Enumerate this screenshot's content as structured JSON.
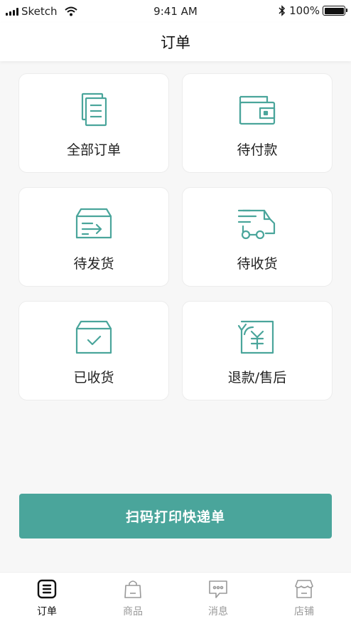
{
  "status_bar": {
    "carrier": "Sketch",
    "time": "9:41 AM",
    "battery": "100%"
  },
  "header": {
    "title": "订单"
  },
  "order_categories": [
    {
      "label": "全部订单",
      "icon": "documents-icon"
    },
    {
      "label": "待付款",
      "icon": "wallet-icon"
    },
    {
      "label": "待发货",
      "icon": "box-arrow-icon"
    },
    {
      "label": "待收货",
      "icon": "truck-icon"
    },
    {
      "label": "已收货",
      "icon": "box-check-icon"
    },
    {
      "label": "退款/售后",
      "icon": "yen-refund-icon"
    }
  ],
  "scan_button": {
    "label": "扫码打印快递单"
  },
  "tab_bar": {
    "items": [
      {
        "label": "订单",
        "icon": "order-list-icon",
        "active": true
      },
      {
        "label": "商品",
        "icon": "shopping-bag-icon",
        "active": false
      },
      {
        "label": "消息",
        "icon": "chat-icon",
        "active": false
      },
      {
        "label": "店铺",
        "icon": "store-icon",
        "active": false
      }
    ]
  },
  "colors": {
    "accent": "#4aa59b",
    "background": "#f7f7f7",
    "card": "#ffffff",
    "inactive_tab": "#999999"
  }
}
